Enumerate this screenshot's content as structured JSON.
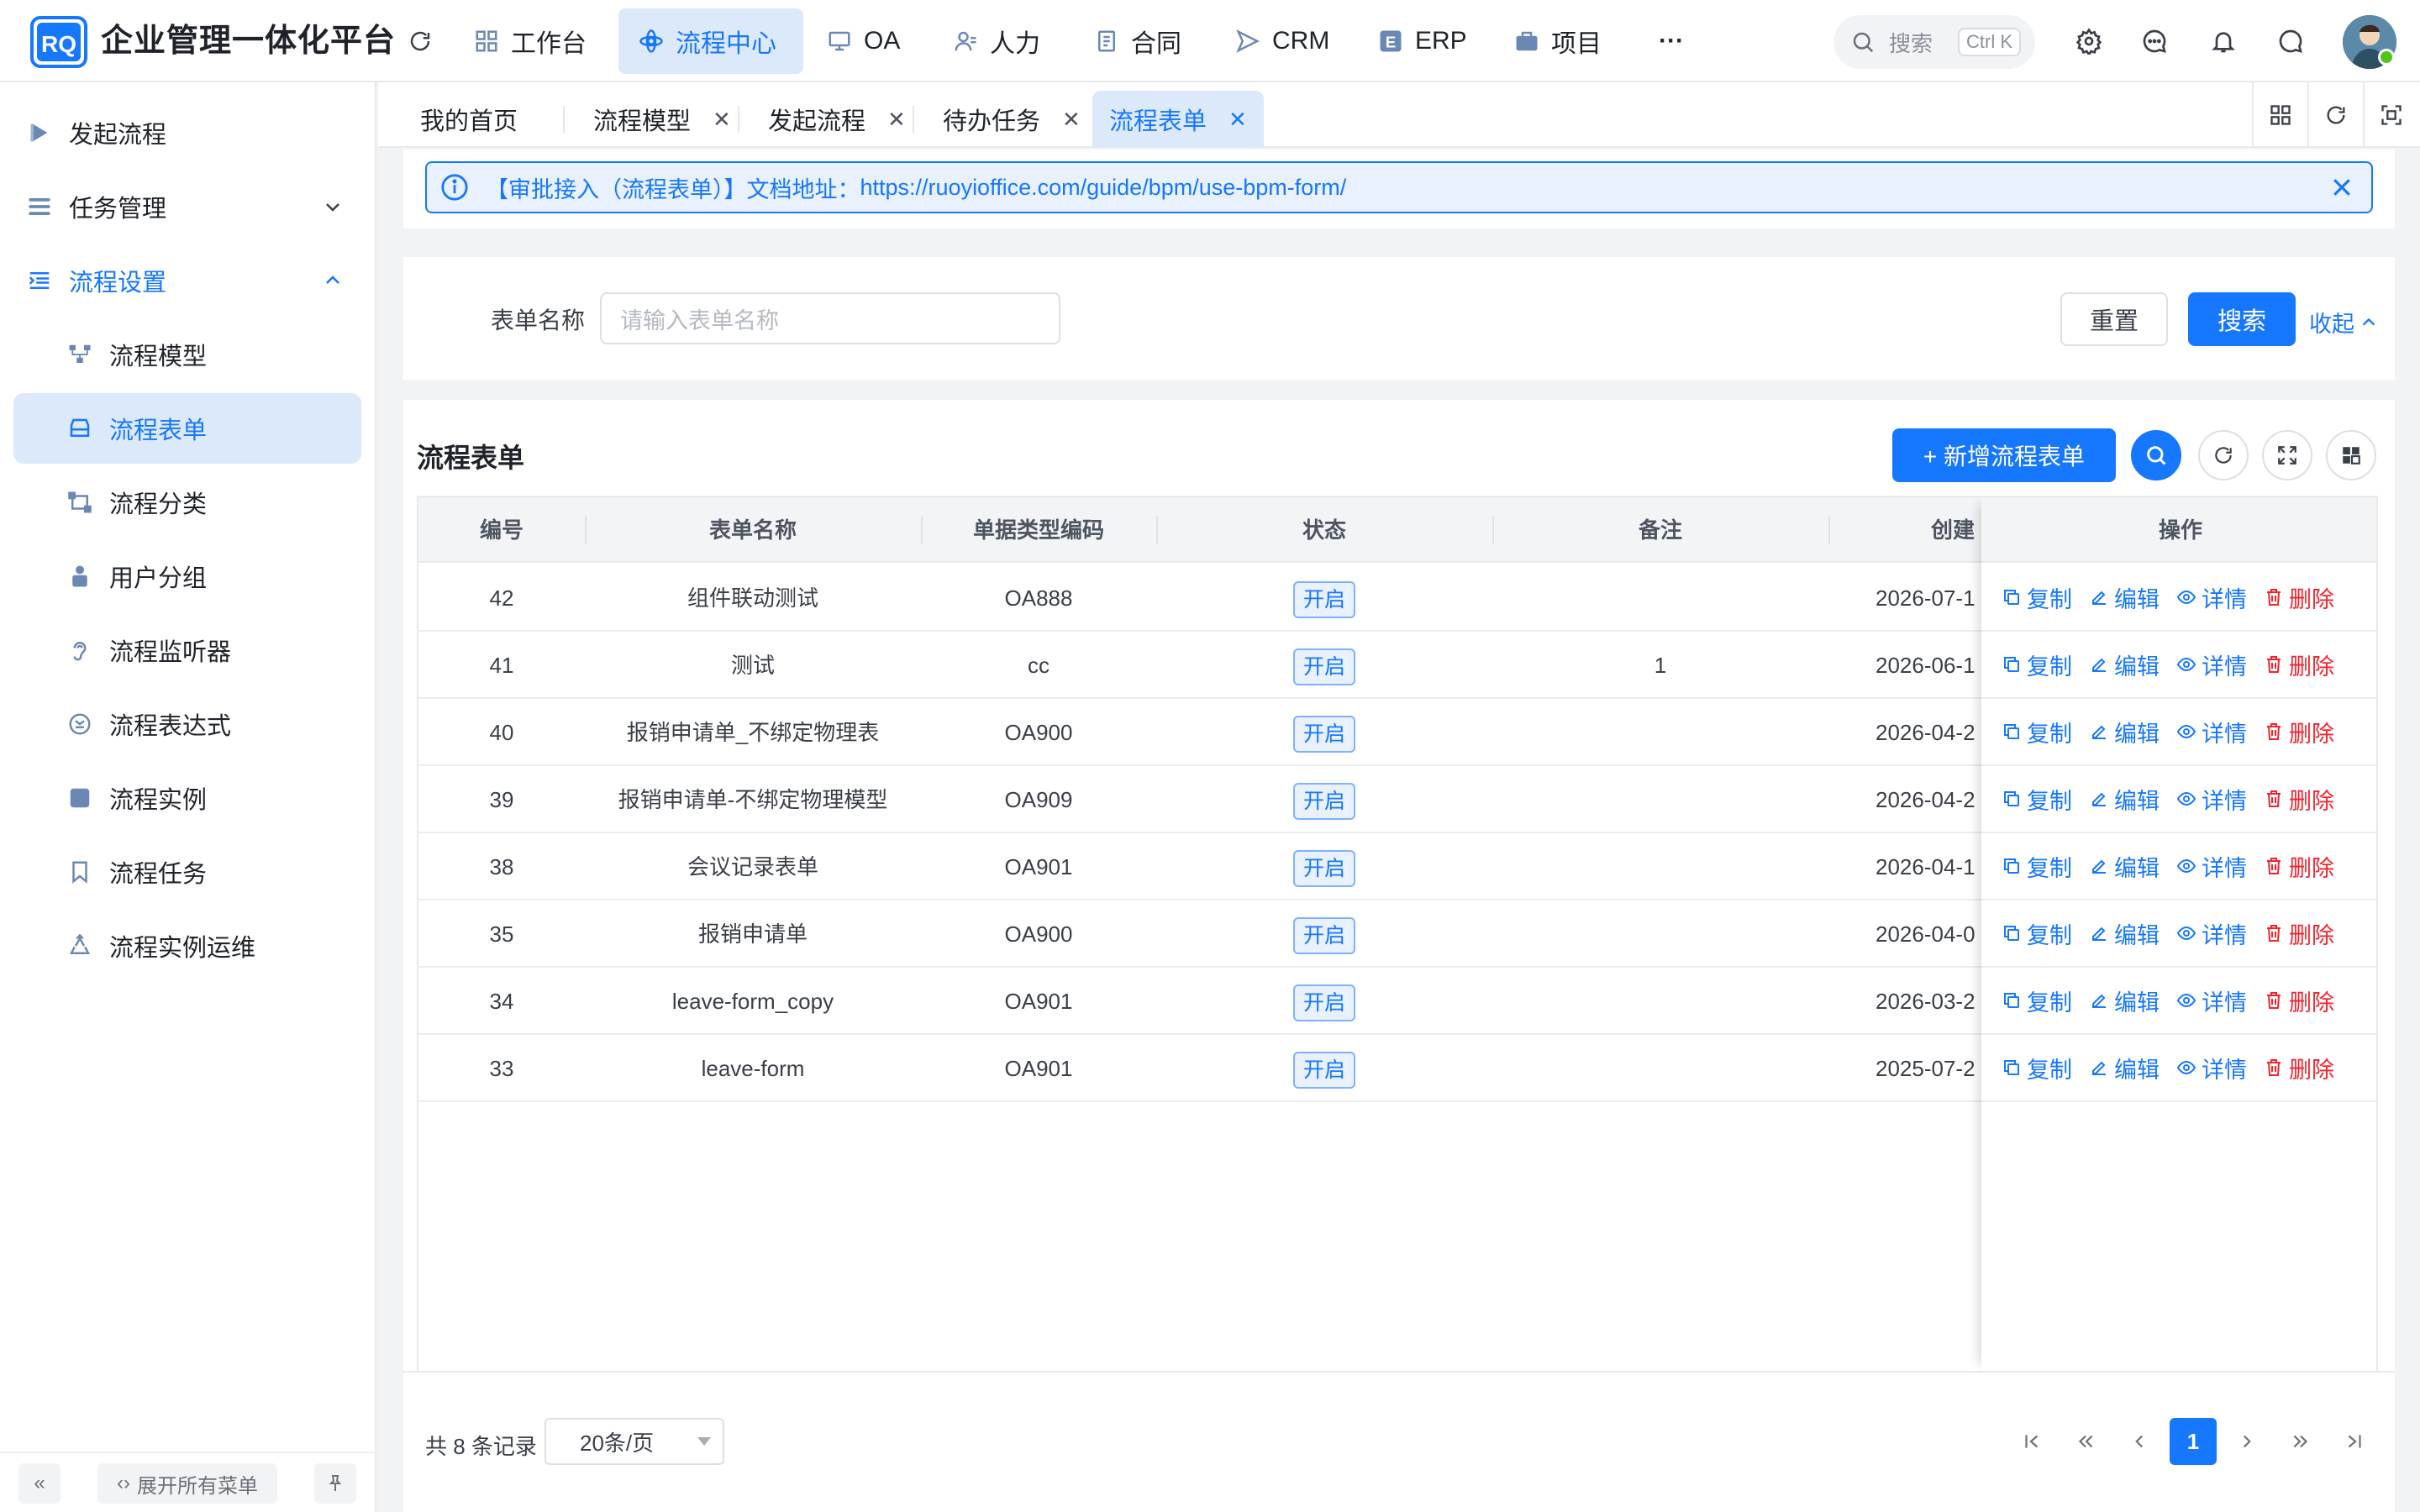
{
  "app": {
    "title": "企业管理一体化平台",
    "logo_text": "RQ"
  },
  "topnav": {
    "items": [
      {
        "label": "工作台",
        "icon": "grid-icon"
      },
      {
        "label": "流程中心",
        "icon": "flow-icon",
        "active": true
      },
      {
        "label": "OA",
        "icon": "monitor-icon"
      },
      {
        "label": "人力",
        "icon": "user-icon"
      },
      {
        "label": "合同",
        "icon": "document-icon"
      },
      {
        "label": "CRM",
        "icon": "send-icon"
      },
      {
        "label": "ERP",
        "icon": "erp-icon"
      },
      {
        "label": "项目",
        "icon": "briefcase-icon"
      }
    ],
    "more": "···",
    "search_placeholder": "搜索",
    "search_shortcut": "Ctrl K"
  },
  "sidebar": {
    "items": [
      {
        "label": "发起流程",
        "icon": "play-icon"
      },
      {
        "label": "任务管理",
        "icon": "list-icon",
        "expandable": true
      },
      {
        "label": "流程设置",
        "icon": "indent-icon",
        "expanded": true
      },
      {
        "label": "流程模型",
        "icon": "model-icon",
        "sub": true
      },
      {
        "label": "流程表单",
        "icon": "form-icon",
        "sub": true,
        "active": true
      },
      {
        "label": "流程分类",
        "icon": "category-icon",
        "sub": true
      },
      {
        "label": "用户分组",
        "icon": "group-icon",
        "sub": true
      },
      {
        "label": "流程监听器",
        "icon": "listener-icon",
        "sub": true
      },
      {
        "label": "流程表达式",
        "icon": "expression-icon",
        "sub": true
      },
      {
        "label": "流程实例",
        "icon": "instance-icon",
        "sub": true
      },
      {
        "label": "流程任务",
        "icon": "bookmark-icon",
        "sub": true
      },
      {
        "label": "流程实例运维",
        "icon": "recycle-icon",
        "sub": true
      }
    ],
    "footer": {
      "collapse": "«",
      "expand_all": "展开所有菜单"
    }
  },
  "tabs": [
    {
      "label": "我的首页",
      "closable": false
    },
    {
      "label": "流程模型",
      "closable": true
    },
    {
      "label": "发起流程",
      "closable": true
    },
    {
      "label": "待办任务",
      "closable": true
    },
    {
      "label": "流程表单",
      "closable": true,
      "active": true
    }
  ],
  "alert": {
    "prefix": "【审批接入（流程表单）】文档地址：",
    "link": "https://ruoyioffice.com/guide/bpm/use-bpm-form/"
  },
  "search": {
    "label": "表单名称",
    "placeholder": "请输入表单名称",
    "reset": "重置",
    "submit": "搜索",
    "collapse": "收起"
  },
  "table": {
    "title": "流程表单",
    "add_button": "+ 新增流程表单",
    "columns": [
      "编号",
      "表单名称",
      "单据类型编码",
      "状态",
      "备注",
      "创建",
      "操作"
    ],
    "rows": [
      {
        "id": "42",
        "name": "组件联动测试",
        "code": "OA888",
        "status": "开启",
        "remark": "",
        "created": "2026-07-1"
      },
      {
        "id": "41",
        "name": "测试",
        "code": "cc",
        "status": "开启",
        "remark": "1",
        "created": "2026-06-1"
      },
      {
        "id": "40",
        "name": "报销申请单_不绑定物理表",
        "code": "OA900",
        "status": "开启",
        "remark": "",
        "created": "2026-04-2"
      },
      {
        "id": "39",
        "name": "报销申请单-不绑定物理模型",
        "code": "OA909",
        "status": "开启",
        "remark": "",
        "created": "2026-04-2"
      },
      {
        "id": "38",
        "name": "会议记录表单",
        "code": "OA901",
        "status": "开启",
        "remark": "",
        "created": "2026-04-1"
      },
      {
        "id": "35",
        "name": "报销申请单",
        "code": "OA900",
        "status": "开启",
        "remark": "",
        "created": "2026-04-0"
      },
      {
        "id": "34",
        "name": "leave-form_copy",
        "code": "OA901",
        "status": "开启",
        "remark": "",
        "created": "2026-03-2"
      },
      {
        "id": "33",
        "name": "leave-form",
        "code": "OA901",
        "status": "开启",
        "remark": "",
        "created": "2025-07-2"
      }
    ],
    "actions": {
      "copy": "复制",
      "edit": "编辑",
      "detail": "详情",
      "delete": "删除"
    }
  },
  "pagination": {
    "total_text": "共 8 条记录",
    "page_size": "20条/页",
    "current_page": "1"
  },
  "colors": {
    "primary": "#1677ff",
    "danger": "#f5222d",
    "active_bg": "#dce9fb"
  }
}
